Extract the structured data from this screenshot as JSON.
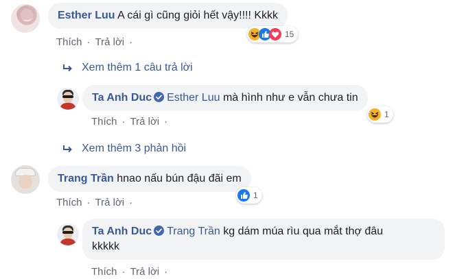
{
  "comments": [
    {
      "author": "Esther Luu",
      "text": "A cái gì cũng giỏi hết vậy!!!! Kkkk",
      "actions": {
        "like": "Thích",
        "reply": "Trả lời"
      },
      "reactions": {
        "icons": [
          "haha-icon",
          "like-icon",
          "love-icon"
        ],
        "count": "15"
      },
      "see_more": "Xem thêm 1 câu trả lời",
      "reply": {
        "author": "Ta Anh Duc",
        "tagged": "Esther Luu",
        "text": "mà hình như e vẫn chưa tin",
        "actions": {
          "like": "Thích",
          "reply": "Trả lời"
        },
        "reactions": {
          "icons": [
            "haha-icon"
          ],
          "count": "1"
        }
      },
      "see_more_2": "Xem thêm 3 phản hồi"
    },
    {
      "author": "Trang Trần",
      "text": "hnao nấu bún đậu đãi em",
      "actions": {
        "like": "Thích",
        "reply": "Trả lời"
      },
      "reactions": {
        "icons": [
          "like-icon"
        ],
        "count": "1"
      },
      "reply": {
        "author": "Ta Anh Duc",
        "tagged": "Trang Trần",
        "text_line1": "kg dám múa rìu qua mắt thợ đâu",
        "text_line2": "kkkkk",
        "actions": {
          "like": "Thích",
          "reply": "Trả lời"
        }
      }
    }
  ],
  "colors": {
    "link": "#385898",
    "bubble": "#f2f3f5",
    "meta": "#606770",
    "like": "#1877f2",
    "love": "#f33e58",
    "haha": "#f7b125"
  }
}
